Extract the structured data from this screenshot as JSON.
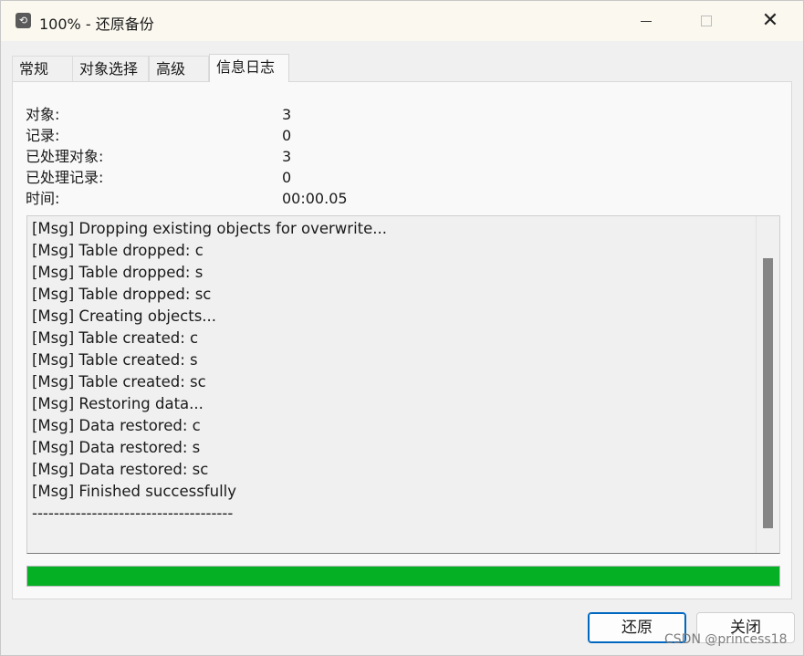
{
  "window": {
    "title": "100% - 还原备份",
    "app_icon": "restore-icon"
  },
  "tabs": [
    {
      "label": "常规",
      "active": false
    },
    {
      "label": "对象选择",
      "active": false
    },
    {
      "label": "高级",
      "active": false
    },
    {
      "label": "信息日志",
      "active": true
    }
  ],
  "stats": [
    {
      "label": "对象:",
      "value": "3"
    },
    {
      "label": "记录:",
      "value": "0"
    },
    {
      "label": "已处理对象:",
      "value": "3"
    },
    {
      "label": "已处理记录:",
      "value": "0"
    },
    {
      "label": "时间:",
      "value": "00:00.05"
    }
  ],
  "log": [
    "[Msg] Dropping existing objects for overwrite...",
    "[Msg] Table dropped: c",
    "[Msg] Table dropped: s",
    "[Msg] Table dropped: sc",
    "[Msg] Creating objects...",
    "[Msg] Table created: c",
    "[Msg] Table created: s",
    "[Msg] Table created: sc",
    "[Msg] Restoring data...",
    "[Msg] Data restored: c",
    "[Msg] Data restored: s",
    "[Msg] Data restored: sc",
    "[Msg] Finished successfully",
    "-------------------------------------"
  ],
  "progress": {
    "percent": 100,
    "color": "#06b025"
  },
  "buttons": {
    "restore_label": "还原",
    "close_label": "关闭"
  },
  "watermark": "CSDN @princess18"
}
